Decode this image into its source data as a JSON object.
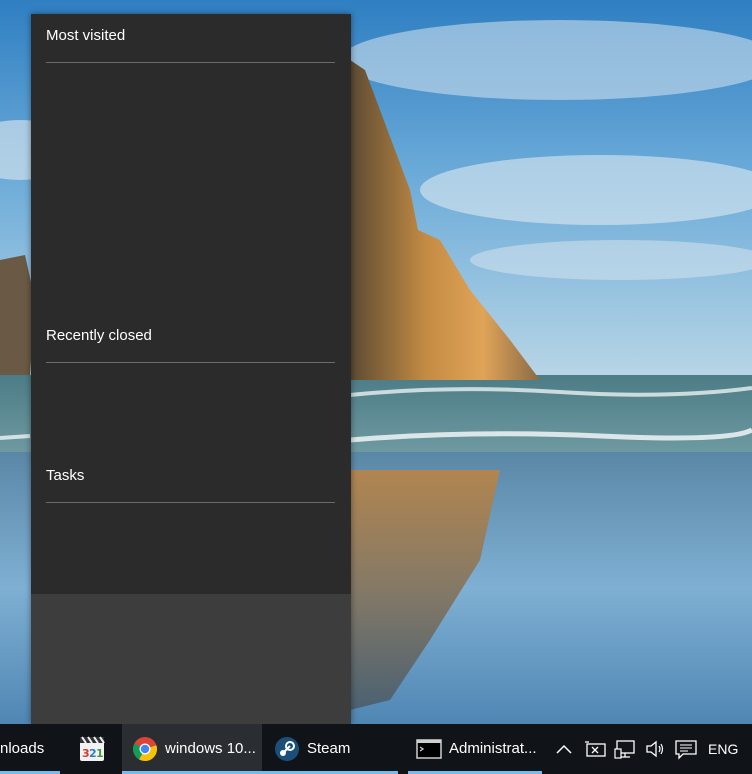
{
  "jumplist": {
    "sections": [
      {
        "header": "Most visited"
      },
      {
        "header": "Recently closed"
      },
      {
        "header": "Tasks"
      }
    ]
  },
  "taskbar": {
    "items": [
      {
        "label": "nloads",
        "icon": "folder-icon",
        "active": true
      },
      {
        "label": "",
        "icon": "media-player-classic-icon",
        "active": false
      },
      {
        "label": "windows 10...",
        "icon": "chrome-icon",
        "active": true
      },
      {
        "label": "Steam",
        "icon": "steam-icon",
        "active": true
      },
      {
        "label": "Administrat...",
        "icon": "command-prompt-icon",
        "active": true
      }
    ],
    "tray": {
      "chevron_icon": "show-hidden-icons-chevron-icon",
      "icons": [
        "input-indicator-icon",
        "network-icon",
        "volume-icon",
        "action-center-icon"
      ],
      "language": "ENG"
    }
  },
  "colors": {
    "jumplist_bg": "#2b2b2b",
    "jumplist_footer": "#3d3d3d",
    "taskbar_bg": "#101418",
    "indicator": "#76b9ed"
  }
}
